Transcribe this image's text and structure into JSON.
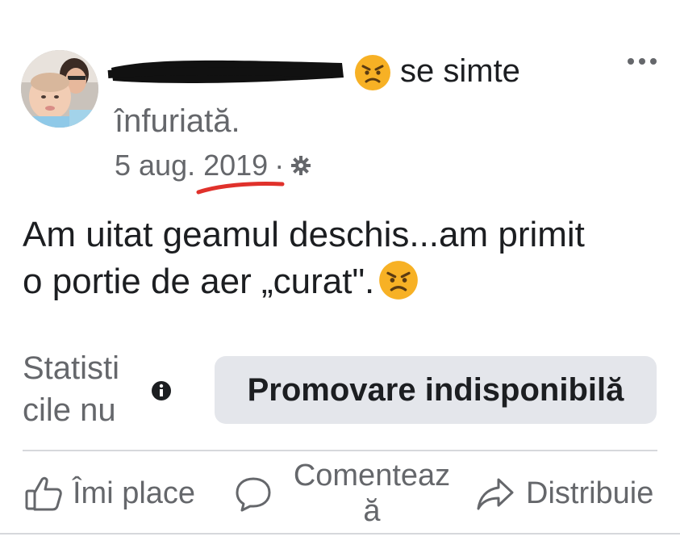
{
  "post": {
    "feeling_emoji": "angry-face",
    "feeling_text": "se simte",
    "feeling_word": "înfuriată.",
    "date": "5 aug.",
    "year": "2019",
    "separator": "·",
    "privacy_icon": "gear-icon",
    "body_line1": "Am uitat geamul deschis...am primit",
    "body_line2": "o portie de aer „curat\".",
    "body_emoji": "angry-face"
  },
  "stats": {
    "label_line1": "Statisti",
    "label_line2": "cile nu",
    "info_icon": "info-icon",
    "promo_button": "Promovare indisponibilă"
  },
  "actions": {
    "like": "Îmi place",
    "comment_line1": "Comenteaz",
    "comment_line2": "ă",
    "share": "Distribuie"
  },
  "colors": {
    "text_primary": "#1c1e21",
    "text_secondary": "#65676b",
    "button_bg": "#e4e6eb",
    "emoji_yellow": "#f7b125",
    "annotation_red": "#e0312b"
  }
}
